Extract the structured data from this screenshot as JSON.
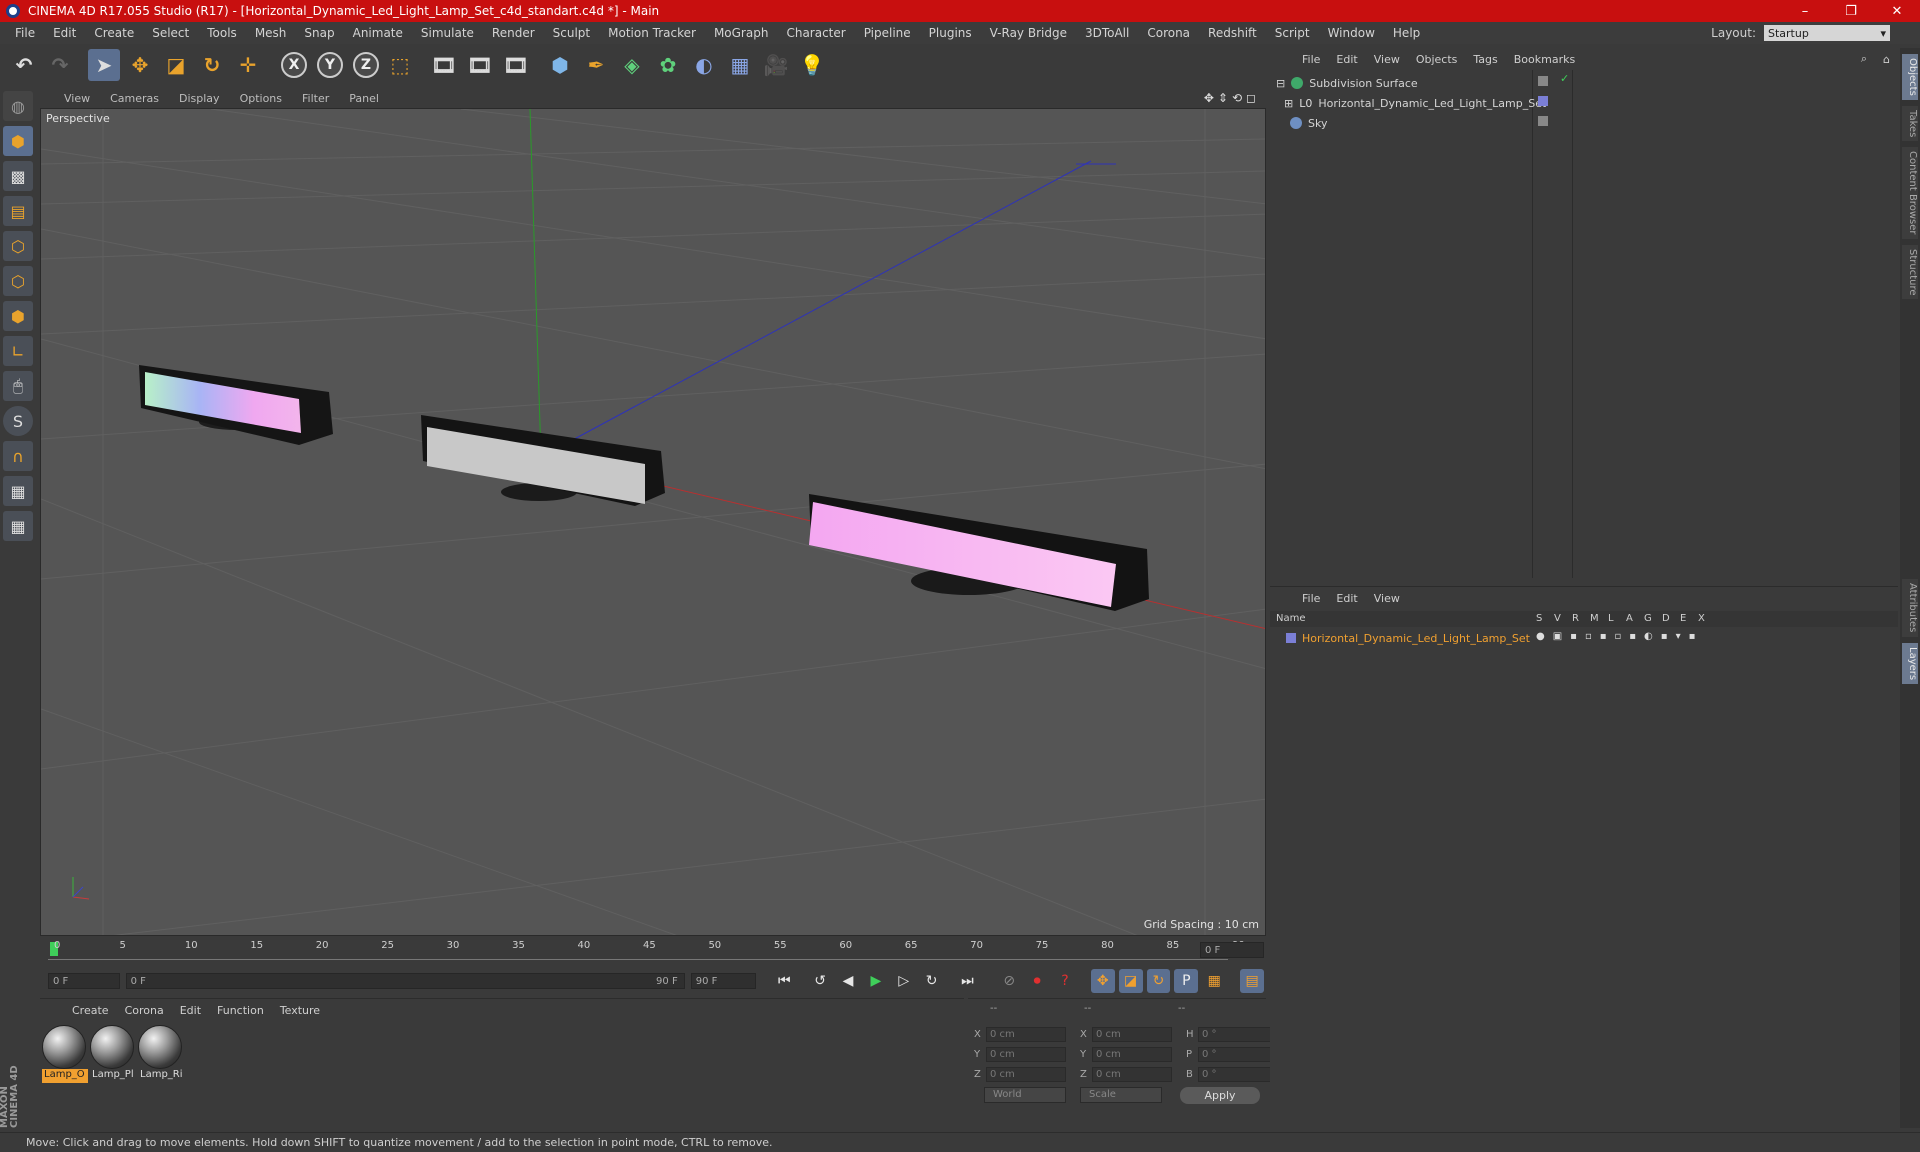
{
  "window": {
    "title": "CINEMA 4D R17.055 Studio (R17) - [Horizontal_Dynamic_Led_Light_Lamp_Set_c4d_standart.c4d *] - Main",
    "controls": [
      "–",
      "❐",
      "✕"
    ]
  },
  "menubar": {
    "items": [
      "File",
      "Edit",
      "Create",
      "Select",
      "Tools",
      "Mesh",
      "Snap",
      "Animate",
      "Simulate",
      "Render",
      "Sculpt",
      "Motion Tracker",
      "MoGraph",
      "Character",
      "Pipeline",
      "Plugins",
      "V-Ray Bridge",
      "3DToAll",
      "Corona",
      "Redshift",
      "Script",
      "Window",
      "Help"
    ],
    "layout_label": "Layout:",
    "layout_value": "Startup"
  },
  "toolbar": {
    "axes": [
      "X",
      "Y",
      "Z"
    ]
  },
  "viewport": {
    "menu": [
      "View",
      "Cameras",
      "Display",
      "Options",
      "Filter",
      "Panel"
    ],
    "camera_label": "Perspective",
    "grid_spacing": "Grid Spacing : 10 cm"
  },
  "timeline": {
    "ticks": [
      "0",
      "5",
      "10",
      "15",
      "20",
      "25",
      "30",
      "35",
      "40",
      "45",
      "50",
      "55",
      "60",
      "65",
      "70",
      "75",
      "80",
      "85",
      "90"
    ],
    "current_frame": "0 F",
    "start_field": "0 F",
    "range_start": "0 F",
    "range_end": "90 F",
    "end_field": "90 F"
  },
  "materials": {
    "menu": [
      "Create",
      "Corona",
      "Edit",
      "Function",
      "Texture"
    ],
    "items": [
      {
        "name": "Lamp_O",
        "selected": true
      },
      {
        "name": "Lamp_Pl",
        "selected": false
      },
      {
        "name": "Lamp_Ri",
        "selected": false
      }
    ]
  },
  "coordinates": {
    "header": [
      "--",
      "--",
      "--"
    ],
    "rows": [
      {
        "l1": "X",
        "v1": "0 cm",
        "l2": "X",
        "v2": "0 cm",
        "l3": "H",
        "v3": "0 °"
      },
      {
        "l1": "Y",
        "v1": "0 cm",
        "l2": "Y",
        "v2": "0 cm",
        "l3": "P",
        "v3": "0 °"
      },
      {
        "l1": "Z",
        "v1": "0 cm",
        "l2": "Z",
        "v2": "0 cm",
        "l3": "B",
        "v3": "0 °"
      }
    ],
    "world": "World",
    "scale": "Scale",
    "apply": "Apply"
  },
  "object_manager": {
    "menu": [
      "File",
      "Edit",
      "View",
      "Objects",
      "Tags",
      "Bookmarks"
    ],
    "objects": [
      {
        "name": "Subdivision Surface",
        "icon_color": "#3fa96a"
      },
      {
        "name": "Horizontal_Dynamic_Led_Light_Lamp_Set",
        "icon_color": "#d8d8d8"
      },
      {
        "name": "Sky",
        "icon_color": "#6e8fc2"
      }
    ]
  },
  "layer_manager": {
    "menu": [
      "File",
      "Edit",
      "View"
    ],
    "columns": [
      "Name",
      "S",
      "V",
      "R",
      "M",
      "L",
      "A",
      "G",
      "D",
      "E",
      "X"
    ],
    "layers": [
      {
        "name": "Horizontal_Dynamic_Led_Light_Lamp_Set",
        "color": "#7b7fd6"
      }
    ]
  },
  "right_tabs": [
    "Objects",
    "Takes",
    "Content Browser",
    "Structure",
    "Attributes",
    "Layers"
  ],
  "status": "Move: Click and drag to move elements. Hold down SHIFT to quantize movement / add to the selection in point mode, CTRL to remove.",
  "branding": "MAXON CINEMA 4D",
  "colors": {
    "title_bar": "#c80f0f",
    "accent": "#f0a030",
    "selected_layer_text": "#f0a030"
  }
}
